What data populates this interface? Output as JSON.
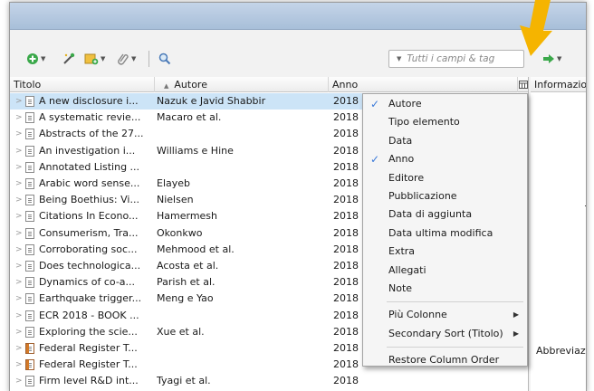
{
  "toolbar": {
    "icons": [
      "new-item-icon",
      "magic-wand-icon",
      "add-attachment-icon",
      "paperclip-icon",
      "search-icon",
      "forward-arrow-icon"
    ],
    "search_placeholder": "Tutti i campi & tag"
  },
  "columns": {
    "title": "Titolo",
    "author": "Autore",
    "year": "Anno"
  },
  "side_panel": {
    "header": "Informazio",
    "fragment_t": "T",
    "fragment_abbr": "Abbreviazi"
  },
  "rows": [
    {
      "title": "A new disclosure i...",
      "author": "Nazuk e Javid Shabbir",
      "year": "2018",
      "type": "doc"
    },
    {
      "title": "A systematic revie...",
      "author": "Macaro et al.",
      "year": "2018",
      "type": "doc"
    },
    {
      "title": "Abstracts of the 27...",
      "author": "",
      "year": "2018",
      "type": "doc"
    },
    {
      "title": "An investigation i...",
      "author": "Williams e Hine",
      "year": "2018",
      "type": "doc"
    },
    {
      "title": "Annotated Listing ...",
      "author": "",
      "year": "2018",
      "type": "doc"
    },
    {
      "title": "Arabic word sense...",
      "author": "Elayeb",
      "year": "2018",
      "type": "doc"
    },
    {
      "title": "Being Boethius: Vi...",
      "author": "Nielsen",
      "year": "2018",
      "type": "doc"
    },
    {
      "title": "Citations In Econo...",
      "author": "Hamermesh",
      "year": "2018",
      "type": "doc"
    },
    {
      "title": "Consumerism, Tra...",
      "author": "Okonkwo",
      "year": "2018",
      "type": "doc"
    },
    {
      "title": "Corroborating soc...",
      "author": "Mehmood et al.",
      "year": "2018",
      "type": "doc"
    },
    {
      "title": "Does technologica...",
      "author": "Acosta et al.",
      "year": "2018",
      "type": "doc"
    },
    {
      "title": "Dynamics of co-a...",
      "author": "Parish et al.",
      "year": "2018",
      "type": "doc"
    },
    {
      "title": "Earthquake trigger...",
      "author": "Meng e Yao",
      "year": "2018",
      "type": "doc"
    },
    {
      "title": "ECR 2018 - BOOK ...",
      "author": "",
      "year": "2018",
      "type": "doc"
    },
    {
      "title": "Exploring the scie...",
      "author": "Xue et al.",
      "year": "2018",
      "type": "doc"
    },
    {
      "title": "Federal Register T...",
      "author": "",
      "year": "2018",
      "type": "fed"
    },
    {
      "title": "Federal Register T...",
      "author": "",
      "year": "2018",
      "type": "fed"
    },
    {
      "title": "Firm level R&D int...",
      "author": "Tyagi et al.",
      "year": "2018",
      "type": "doc"
    }
  ],
  "menu": {
    "items": [
      {
        "label": "Autore",
        "checked": true
      },
      {
        "label": "Tipo elemento",
        "checked": false
      },
      {
        "label": "Data",
        "checked": false
      },
      {
        "label": "Anno",
        "checked": true
      },
      {
        "label": "Editore",
        "checked": false
      },
      {
        "label": "Pubblicazione",
        "checked": false
      },
      {
        "label": "Data di aggiunta",
        "checked": false
      },
      {
        "label": "Data ultima modifica",
        "checked": false
      },
      {
        "label": "Extra",
        "checked": false
      },
      {
        "label": "Allegati",
        "checked": false
      },
      {
        "label": "Note",
        "checked": false
      }
    ],
    "submenus": [
      "Più Colonne",
      "Secondary Sort (Titolo)"
    ],
    "restore": "Restore Column Order"
  },
  "colors": {
    "selection": "#cce4f7",
    "check": "#3b7ad9",
    "annotation_arrow": "#f5b400"
  }
}
